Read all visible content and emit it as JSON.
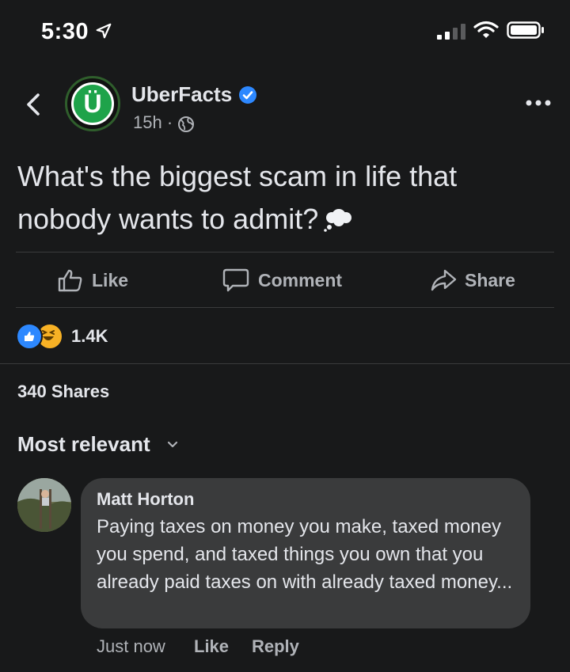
{
  "status_bar": {
    "time": "5:30"
  },
  "header": {
    "page_name": "UberFacts",
    "avatar_letter": "Ü",
    "post_time": "15h ·"
  },
  "post": {
    "text": "What's the biggest scam in life that nobody wants to admit?"
  },
  "actions": {
    "like": "Like",
    "comment": "Comment",
    "share": "Share"
  },
  "reactions": {
    "count": "1.4K"
  },
  "shares": "340 Shares",
  "sort": {
    "label": "Most relevant"
  },
  "comment": {
    "author": "Matt Horton",
    "text": "Paying taxes on money you make, taxed money you spend, and taxed things you own that you already paid taxes on with already taxed money...",
    "time": "Just now",
    "like": "Like",
    "reply": "Reply"
  },
  "colors": {
    "background": "#18191a",
    "bubble": "#3a3b3c",
    "like_blue": "#2d88ff",
    "verified_blue": "#2d88ff",
    "haha_yellow": "#f7b125"
  },
  "icons": [
    "location-arrow-icon",
    "signal-icon",
    "wifi-icon",
    "battery-icon",
    "back-icon",
    "verified-icon",
    "globe-icon",
    "more-icon",
    "thought-bubble-icon",
    "like-icon",
    "comment-icon",
    "share-icon",
    "chevron-down-icon"
  ]
}
